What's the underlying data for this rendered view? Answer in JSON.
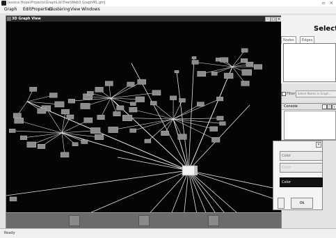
{
  "app": {
    "title": "Jessica Hope\\Projects\\GraphLib\\Tree\\Web3 GraphML.gml"
  },
  "window_controls": [
    "▫",
    "×"
  ],
  "menu": [
    {
      "label": "Graph",
      "key": "G"
    },
    {
      "label": "Edit",
      "key": "E"
    },
    {
      "label": "Properties",
      "key": "P"
    },
    {
      "label": "Clustering",
      "key": "C"
    },
    {
      "label": "View",
      "key": "V"
    },
    {
      "label": "Windows",
      "key": "W"
    }
  ],
  "graph_view": {
    "title": "3D Graph View",
    "buttons": [
      "-",
      "□",
      "×"
    ]
  },
  "right_panel": {
    "title": "Select",
    "tabs": [
      "Nodes",
      "Edges"
    ]
  },
  "filter": {
    "label": "Filter",
    "button": "Select Nodes in Graph..."
  },
  "console": {
    "title": "Console",
    "buttons": [
      "-",
      "□",
      "×"
    ]
  },
  "dialog": {
    "close": "×",
    "buttons": [
      {
        "label": "Color",
        "state": "normal"
      },
      {
        "label": "Color",
        "state": "disabled"
      },
      {
        "label": "Color",
        "state": "active"
      }
    ],
    "ok": "Ok"
  },
  "status": {
    "text": "Ready"
  },
  "colors": {
    "canvas_bg": "#050505",
    "edge": "#e6e6e6",
    "node": "#8c8c8c"
  }
}
